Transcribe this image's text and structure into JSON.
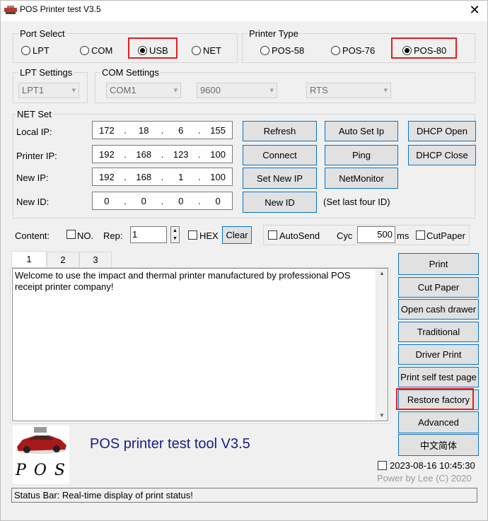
{
  "window": {
    "title": "POS Printer test V3.5",
    "close_glyph": "✕"
  },
  "port_select": {
    "label": "Port Select",
    "options": [
      "LPT",
      "COM",
      "USB",
      "NET"
    ],
    "selected": "USB"
  },
  "printer_type": {
    "label": "Printer Type",
    "options": [
      "POS-58",
      "POS-76",
      "POS-80"
    ],
    "selected": "POS-80"
  },
  "lpt_settings": {
    "label": "LPT Settings",
    "port": "LPT1"
  },
  "com_settings": {
    "label": "COM Settings",
    "port": "COM1",
    "baud": "9600",
    "flow": "RTS"
  },
  "net_set": {
    "label": "NET Set",
    "local_ip_label": "Local IP:",
    "local_ip": [
      "172",
      "18",
      "6",
      "155"
    ],
    "printer_ip_label": "Printer IP:",
    "printer_ip": [
      "192",
      "168",
      "123",
      "100"
    ],
    "new_ip_label": "New IP:",
    "new_ip": [
      "192",
      "168",
      "1",
      "100"
    ],
    "new_id_label": "New ID:",
    "new_id": [
      "0",
      "0",
      "0",
      "0"
    ],
    "id_hint": "(Set last four ID)",
    "buttons": {
      "refresh": "Refresh",
      "auto_set_ip": "Auto Set Ip",
      "dhcp_open": "DHCP Open",
      "connect": "Connect",
      "ping": "Ping",
      "dhcp_close": "DHCP Close",
      "set_new_ip": "Set New IP",
      "net_monitor": "NetMonitor",
      "new_id": "New ID"
    }
  },
  "content_row": {
    "content_label": "Content:",
    "no_label": "NO.",
    "rep_label": "Rep:",
    "rep_value": "1",
    "hex_label": "HEX",
    "clear_label": "Clear",
    "autosend_label": "AutoSend",
    "cyc_label": "Cyc",
    "cyc_value": "500",
    "ms_label": "ms",
    "cutpaper_label": "CutPaper"
  },
  "tabs": [
    "1",
    "2",
    "3"
  ],
  "text_content": "Welcome to use the impact and thermal printer manufactured by professional POS receipt printer company!",
  "right_buttons": {
    "print": "Print",
    "cut_paper": "Cut Paper",
    "open_cash_drawer": "Open cash drawer",
    "traditional": "Traditional",
    "driver_print": "Driver Print",
    "print_self_test": "Print self test page",
    "restore_factory": "Restore factory",
    "advanced": "Advanced",
    "chinese": "中文简体"
  },
  "logo_text": "P O S",
  "tool_title": "POS printer test tool V3.5",
  "datetime": "2023-08-16 10:45:30",
  "credit": "Power by Lee (C) 2020",
  "status_bar": "Status Bar: Real-time display of print status!",
  "colors": {
    "highlight": "#e02020",
    "title_blue": "#1a1a8c",
    "accent": "#0a73c8"
  }
}
